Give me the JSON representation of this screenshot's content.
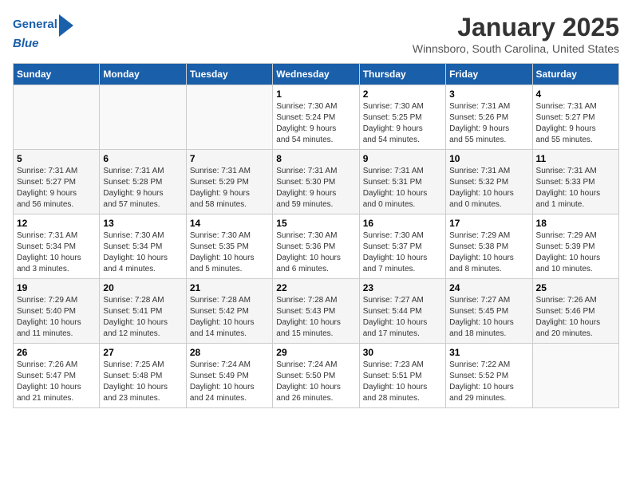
{
  "logo": {
    "line1": "General",
    "line2": "Blue"
  },
  "title": "January 2025",
  "subtitle": "Winnsboro, South Carolina, United States",
  "days_of_week": [
    "Sunday",
    "Monday",
    "Tuesday",
    "Wednesday",
    "Thursday",
    "Friday",
    "Saturday"
  ],
  "weeks": [
    [
      {
        "day": "",
        "info": ""
      },
      {
        "day": "",
        "info": ""
      },
      {
        "day": "",
        "info": ""
      },
      {
        "day": "1",
        "info": "Sunrise: 7:30 AM\nSunset: 5:24 PM\nDaylight: 9 hours\nand 54 minutes."
      },
      {
        "day": "2",
        "info": "Sunrise: 7:30 AM\nSunset: 5:25 PM\nDaylight: 9 hours\nand 54 minutes."
      },
      {
        "day": "3",
        "info": "Sunrise: 7:31 AM\nSunset: 5:26 PM\nDaylight: 9 hours\nand 55 minutes."
      },
      {
        "day": "4",
        "info": "Sunrise: 7:31 AM\nSunset: 5:27 PM\nDaylight: 9 hours\nand 55 minutes."
      }
    ],
    [
      {
        "day": "5",
        "info": "Sunrise: 7:31 AM\nSunset: 5:27 PM\nDaylight: 9 hours\nand 56 minutes."
      },
      {
        "day": "6",
        "info": "Sunrise: 7:31 AM\nSunset: 5:28 PM\nDaylight: 9 hours\nand 57 minutes."
      },
      {
        "day": "7",
        "info": "Sunrise: 7:31 AM\nSunset: 5:29 PM\nDaylight: 9 hours\nand 58 minutes."
      },
      {
        "day": "8",
        "info": "Sunrise: 7:31 AM\nSunset: 5:30 PM\nDaylight: 9 hours\nand 59 minutes."
      },
      {
        "day": "9",
        "info": "Sunrise: 7:31 AM\nSunset: 5:31 PM\nDaylight: 10 hours\nand 0 minutes."
      },
      {
        "day": "10",
        "info": "Sunrise: 7:31 AM\nSunset: 5:32 PM\nDaylight: 10 hours\nand 0 minutes."
      },
      {
        "day": "11",
        "info": "Sunrise: 7:31 AM\nSunset: 5:33 PM\nDaylight: 10 hours\nand 1 minute."
      }
    ],
    [
      {
        "day": "12",
        "info": "Sunrise: 7:31 AM\nSunset: 5:34 PM\nDaylight: 10 hours\nand 3 minutes."
      },
      {
        "day": "13",
        "info": "Sunrise: 7:30 AM\nSunset: 5:34 PM\nDaylight: 10 hours\nand 4 minutes."
      },
      {
        "day": "14",
        "info": "Sunrise: 7:30 AM\nSunset: 5:35 PM\nDaylight: 10 hours\nand 5 minutes."
      },
      {
        "day": "15",
        "info": "Sunrise: 7:30 AM\nSunset: 5:36 PM\nDaylight: 10 hours\nand 6 minutes."
      },
      {
        "day": "16",
        "info": "Sunrise: 7:30 AM\nSunset: 5:37 PM\nDaylight: 10 hours\nand 7 minutes."
      },
      {
        "day": "17",
        "info": "Sunrise: 7:29 AM\nSunset: 5:38 PM\nDaylight: 10 hours\nand 8 minutes."
      },
      {
        "day": "18",
        "info": "Sunrise: 7:29 AM\nSunset: 5:39 PM\nDaylight: 10 hours\nand 10 minutes."
      }
    ],
    [
      {
        "day": "19",
        "info": "Sunrise: 7:29 AM\nSunset: 5:40 PM\nDaylight: 10 hours\nand 11 minutes."
      },
      {
        "day": "20",
        "info": "Sunrise: 7:28 AM\nSunset: 5:41 PM\nDaylight: 10 hours\nand 12 minutes."
      },
      {
        "day": "21",
        "info": "Sunrise: 7:28 AM\nSunset: 5:42 PM\nDaylight: 10 hours\nand 14 minutes."
      },
      {
        "day": "22",
        "info": "Sunrise: 7:28 AM\nSunset: 5:43 PM\nDaylight: 10 hours\nand 15 minutes."
      },
      {
        "day": "23",
        "info": "Sunrise: 7:27 AM\nSunset: 5:44 PM\nDaylight: 10 hours\nand 17 minutes."
      },
      {
        "day": "24",
        "info": "Sunrise: 7:27 AM\nSunset: 5:45 PM\nDaylight: 10 hours\nand 18 minutes."
      },
      {
        "day": "25",
        "info": "Sunrise: 7:26 AM\nSunset: 5:46 PM\nDaylight: 10 hours\nand 20 minutes."
      }
    ],
    [
      {
        "day": "26",
        "info": "Sunrise: 7:26 AM\nSunset: 5:47 PM\nDaylight: 10 hours\nand 21 minutes."
      },
      {
        "day": "27",
        "info": "Sunrise: 7:25 AM\nSunset: 5:48 PM\nDaylight: 10 hours\nand 23 minutes."
      },
      {
        "day": "28",
        "info": "Sunrise: 7:24 AM\nSunset: 5:49 PM\nDaylight: 10 hours\nand 24 minutes."
      },
      {
        "day": "29",
        "info": "Sunrise: 7:24 AM\nSunset: 5:50 PM\nDaylight: 10 hours\nand 26 minutes."
      },
      {
        "day": "30",
        "info": "Sunrise: 7:23 AM\nSunset: 5:51 PM\nDaylight: 10 hours\nand 28 minutes."
      },
      {
        "day": "31",
        "info": "Sunrise: 7:22 AM\nSunset: 5:52 PM\nDaylight: 10 hours\nand 29 minutes."
      },
      {
        "day": "",
        "info": ""
      }
    ]
  ]
}
